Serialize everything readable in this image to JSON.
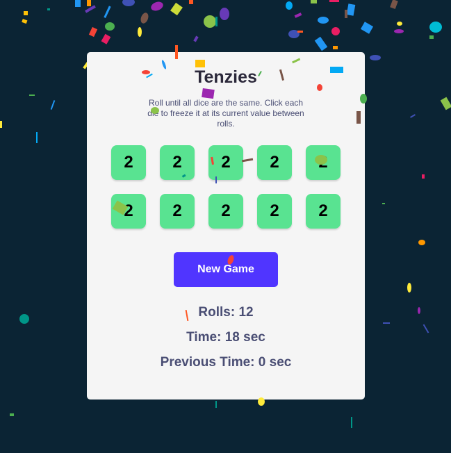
{
  "game": {
    "title": "Tenzies",
    "instructions": "Roll until all dice are the same. Click each die to freeze it at its current value between rolls.",
    "dice": [
      "2",
      "2",
      "2",
      "2",
      "2",
      "2",
      "2",
      "2",
      "2",
      "2"
    ],
    "die_color": "#59e391",
    "new_game_label": "New Game",
    "button_color": "#5035ff",
    "rolls_text": "Rolls: 12",
    "time_text": "Time: 18 sec",
    "previous_time_text": "Previous Time: 0 sec"
  },
  "theme": {
    "background": "#0b2434",
    "card": "#f5f5f5"
  }
}
